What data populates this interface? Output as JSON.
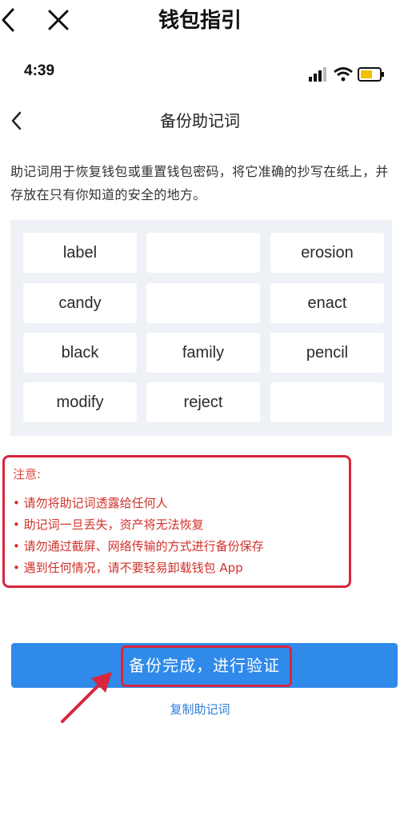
{
  "outer_header": {
    "title": "钱包指引"
  },
  "status_bar": {
    "time": "4:39"
  },
  "inner_nav": {
    "title": "备份助记词"
  },
  "description": "助记词用于恢复钱包或重置钱包密码，将它准确的抄写在纸上，并存放在只有你知道的安全的地方。",
  "mnemonic_words": [
    "label",
    "",
    "erosion",
    "candy",
    "",
    "enact",
    "black",
    "family",
    "pencil",
    "modify",
    "reject",
    ""
  ],
  "notice": {
    "title": "注意:",
    "items": [
      "• 请勿将助记词透露给任何人",
      "• 助记词一旦丢失，资产将无法恢复",
      "• 请勿通过截屏、网络传输的方式进行备份保存",
      "• 遇到任何情况，请不要轻易卸载钱包 App"
    ]
  },
  "actions": {
    "primary_label": "备份完成，进行验证",
    "copy_label": "复制助记词"
  },
  "colors": {
    "accent": "#2f8aea",
    "warning": "#d7263d"
  }
}
